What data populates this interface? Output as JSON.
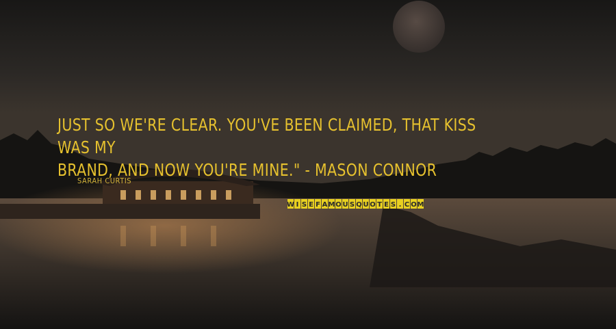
{
  "quote": {
    "line1": "Just so we're clear. You've been claimed, that kiss was my",
    "line2": "brand, and now you're mine.\" - Mason Connor",
    "author": "Sarah Curtis",
    "color": "#e6c12e"
  },
  "watermark": {
    "text": "WISEFAMOUSQUOTES.COM",
    "colors": [
      "#e8d020",
      "#2a2a2a"
    ]
  }
}
